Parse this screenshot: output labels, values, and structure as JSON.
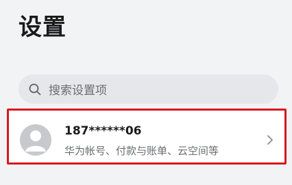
{
  "header": {
    "title": "设置"
  },
  "search": {
    "placeholder": "搜索设置项",
    "icon": "search-icon"
  },
  "account": {
    "name": "187******06",
    "subtitle": "华为帐号、付款与账单、云空间等",
    "avatar_icon": "avatar-person-icon",
    "chevron_icon": "chevron-right-icon",
    "highlight_color": "#d9161d"
  }
}
